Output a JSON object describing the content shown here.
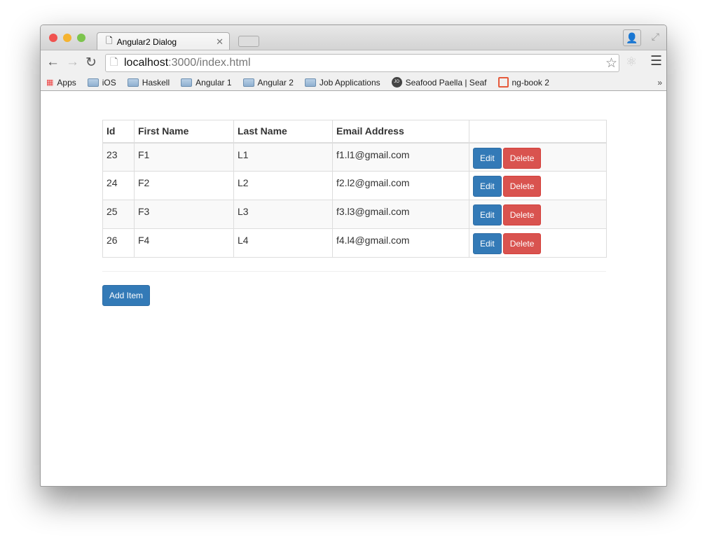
{
  "browser": {
    "tab_title": "Angular2 Dialog",
    "url_host": "localhost",
    "url_rest": ":3000/index.html",
    "bookmarks": [
      {
        "label": "Apps",
        "icon": "apps-grid-icon"
      },
      {
        "label": "iOS",
        "icon": "folder-icon"
      },
      {
        "label": "Haskell",
        "icon": "folder-icon"
      },
      {
        "label": "Angular 1",
        "icon": "folder-icon"
      },
      {
        "label": "Angular 2",
        "icon": "folder-icon"
      },
      {
        "label": "Job Applications",
        "icon": "folder-icon"
      },
      {
        "label": "Seafood Paella | Seaf",
        "icon": "jo-avatar-icon"
      },
      {
        "label": "ng-book 2",
        "icon": "ng-book-icon"
      }
    ]
  },
  "table": {
    "headers": [
      "Id",
      "First Name",
      "Last Name",
      "Email Address",
      ""
    ],
    "rows": [
      {
        "id": "23",
        "first": "F1",
        "last": "L1",
        "email": "f1.l1@gmail.com"
      },
      {
        "id": "24",
        "first": "F2",
        "last": "L2",
        "email": "f2.l2@gmail.com"
      },
      {
        "id": "25",
        "first": "F3",
        "last": "L3",
        "email": "f3.l3@gmail.com"
      },
      {
        "id": "26",
        "first": "F4",
        "last": "L4",
        "email": "f4.l4@gmail.com"
      }
    ],
    "edit_label": "Edit",
    "delete_label": "Delete"
  },
  "add_label": "Add Item",
  "colors": {
    "primary": "#337ab7",
    "danger": "#d9534f"
  }
}
